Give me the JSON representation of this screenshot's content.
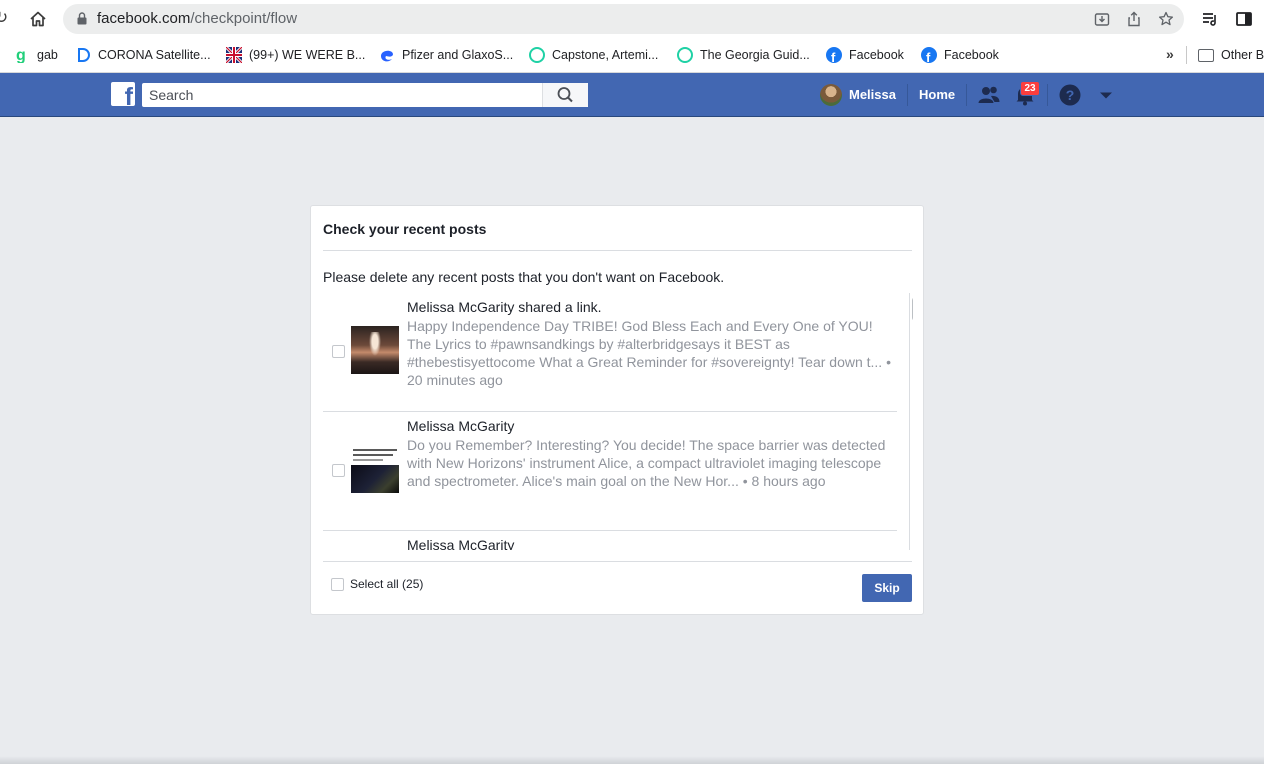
{
  "browser": {
    "url_host": "facebook.com",
    "url_path": "/checkpoint/flow",
    "bookmarks": [
      {
        "label": "gab",
        "icon": "gab-icon",
        "color": "#21cf7a"
      },
      {
        "label": "CORONA Satellite...",
        "icon": "d-logo-icon",
        "color": "#1877f2"
      },
      {
        "label": "(99+) WE WERE B...",
        "icon": "flag-icon",
        "color": "#b22234"
      },
      {
        "label": "Pfizer and GlaxoS...",
        "icon": "edge-icon",
        "color": "#2962ff"
      },
      {
        "label": "Capstone, Artemi...",
        "icon": "circle-app-icon",
        "color": "#1fd1a5"
      },
      {
        "label": "The Georgia Guid...",
        "icon": "circle-app-icon",
        "color": "#1fd1a5"
      },
      {
        "label": "Facebook",
        "icon": "facebook-icon",
        "color": "#1877f2"
      },
      {
        "label": "Facebook",
        "icon": "facebook-icon",
        "color": "#1877f2"
      }
    ],
    "more_bookmarks": "»",
    "other_bookmarks": "Other B"
  },
  "fb_header": {
    "logo": "f",
    "search_placeholder": "Search",
    "user_name": "Melissa",
    "home_label": "Home",
    "notification_count": "23"
  },
  "dialog": {
    "title": "Check your recent posts",
    "description": "Please delete any recent posts that you don't want on Facebook.",
    "posts": [
      {
        "author": "Melissa McGarity shared a link.",
        "text": "Happy Independence Day TRIBE! God Bless Each and Every One of YOU! The Lyrics to #pawnsandkings by #alterbridgesays it BEST as #thebestisyettocome What a Great Reminder for #sovereignty! Tear down t...",
        "separator": " • ",
        "time": "20 minutes ago"
      },
      {
        "author": "Melissa McGarity",
        "text": "Do you Remember? Interesting? You decide! The space barrier was detected with New Horizons' instrument Alice, a compact ultraviolet imaging telescope and spectrometer. Alice's main goal on the New Hor...",
        "separator": " • ",
        "time": "8 hours ago"
      },
      {
        "author": "Melissa McGarity"
      }
    ],
    "select_all": "Select all (25)",
    "skip_label": "Skip"
  },
  "colors": {
    "fb_blue": "#4267b2",
    "badge_red": "#fa3e3e",
    "page_bg": "#e9ebee"
  }
}
